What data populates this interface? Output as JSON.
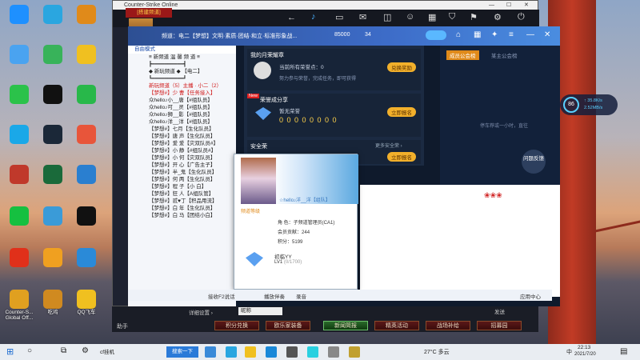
{
  "window_title": "Counter-Strike Online",
  "desktop_icons": [
    {
      "label": "Counter-S..."
    },
    {
      "label": "Global Off..."
    },
    {
      "label": "吃鸡"
    },
    {
      "label": "QQ飞车"
    }
  ],
  "channel_tag": "[搭建频道]",
  "channel_nav": "频道：电二【梦想】文明·素质·团结·和立·标准形象战...",
  "channel_id": "85000",
  "member_count": "34",
  "mode_label": "自由模式",
  "channel_list": [
    {
      "text": "≡ 新频道 温 馨 频 道 ≡",
      "red": false
    },
    {
      "text": "┣━━━━━━━━━━┫",
      "red": false
    },
    {
      "text": "◆ 新玩频道 ◆ 【电二】",
      "red": false
    },
    {
      "text": "┗━━━━━━━━━━┛",
      "red": false
    },
    {
      "text": "新玩频道（5）主播 · 小二（2）",
      "red": true
    },
    {
      "text": "【梦想#】少 曹【任务接入】",
      "red": true
    },
    {
      "text": "众hello♪小__唐【#组队员】",
      "red": false
    },
    {
      "text": "众hello♪可__灵【#组队员】",
      "red": false
    },
    {
      "text": "众hello♪狮__影【#组队员】",
      "red": false
    },
    {
      "text": "众hello♪洋__洋【#组队员】",
      "red": false
    },
    {
      "text": "【梦想#】七月【生化队员】",
      "red": false
    },
    {
      "text": "【梦想#】唐 声【生化队员】",
      "red": false
    },
    {
      "text": "【梦想#】爱 爱【灾双队员#】",
      "red": false
    },
    {
      "text": "【梦想#】小 静【#组队员#】",
      "red": false
    },
    {
      "text": "【梦想#】小 何【灾双队员】",
      "red": false
    },
    {
      "text": "【梦想#】开 心【广告主子】",
      "red": false
    },
    {
      "text": "【梦想#】半_鬼【生化队员】",
      "red": false
    },
    {
      "text": "【梦想#】何 两【生化队员】",
      "red": false
    },
    {
      "text": "【梦想#】程 子【小 白】",
      "red": false
    },
    {
      "text": "【梦想#】狂 人【A组队管】",
      "red": false
    },
    {
      "text": "【梦想#】贰♥丁【积品用流】",
      "red": false
    },
    {
      "text": "【梦想#】白 年【生化队员】",
      "red": false
    },
    {
      "text": "【梦想#】白 马【团结小白】",
      "red": false
    }
  ],
  "left_status": "接收F2说话",
  "cards": {
    "my_month": {
      "title": "我的月荣耀章",
      "sub": "当前所有荣誉点：0",
      "desc": "努力参与荣誉，完成任务，即可获得",
      "btn": "兑换奖励"
    },
    "glory": {
      "badge": "New",
      "title": "荣誉成分享",
      "sub": "暂无荣誉",
      "digits": "0 0 0 0 0 0 0 0",
      "btn": "立即报名"
    },
    "security": {
      "title": "安全荣",
      "more": "更多安全荣 ›",
      "btn": "立即报名"
    }
  },
  "right_tabs": [
    "成员公会榜",
    "某主公会榜"
  ],
  "right_note": "停车荐或一小时，直往",
  "feedback_btn": "问题反馈",
  "profile": {
    "name": "☆hello♪洋__洋【组队】",
    "vip_label": "频道等级",
    "role_label": "角  色：",
    "role": "子频道管理员(CA1)",
    "contrib_label": "会员贡献：",
    "contrib": "244",
    "points_label": "积分：",
    "points": "5199",
    "rank_title": "初临YY",
    "level": "LV1",
    "level_progress": "(0/1700)"
  },
  "chat_input_bar": {
    "nickname_field": "昵称",
    "send": "发送",
    "app_center": "应用中心"
  },
  "status_items": [
    "接收F2说话",
    "播放伴奏",
    "录音"
  ],
  "game_menu": [
    "助手",
    "积分兑换",
    "欧乐家装备",
    "新闻简报",
    "精英活动",
    "战场补给",
    "招募园"
  ],
  "detail_settings": "详细设置 ›",
  "taskbar": {
    "search": "搜索一下",
    "app": "cf挂机",
    "temp": "27°C  多云",
    "time": "22:13",
    "date": "2021/7/20",
    "lang": "中"
  },
  "widget": {
    "value": "86",
    "unit": "%",
    "speed": "↑ 35.8K/s",
    "speed2": "2.52MB/s"
  }
}
